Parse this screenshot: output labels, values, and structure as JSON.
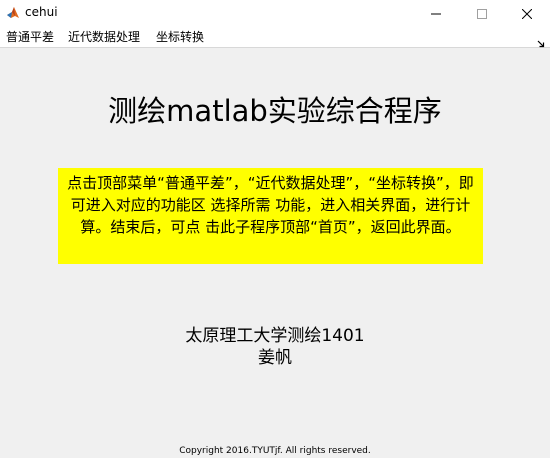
{
  "window": {
    "title": "cehui",
    "app_icon": "matlab-logo-icon",
    "controls": {
      "minimize_icon": "minimize-icon",
      "maximize_icon": "maximize-icon",
      "close_icon": "close-icon"
    }
  },
  "menubar": {
    "items": [
      {
        "label": "普通平差"
      },
      {
        "label": "近代数据处理"
      },
      {
        "label": "坐标转换"
      }
    ],
    "dock_icon": "dock-arrow-icon"
  },
  "main": {
    "title": "测绘matlab实验综合程序",
    "instruction": "点击顶部菜单“普通平差”，“近代数据处理”，“坐标转换”，即可进入对应的功能区 选择所需 功能，进入相关界面，进行计算。结束后，可点 击此子程序顶部“首页”，返回此界面。",
    "author_line1": "太原理工大学测绘1401",
    "author_line2": "姜帆",
    "copyright": "Copyright  2016.TYUTjf. All rights reserved."
  },
  "colors": {
    "background": "#f0f0f0",
    "instruction_bg": "#ffff00",
    "titlebar_bg": "#ffffff"
  }
}
